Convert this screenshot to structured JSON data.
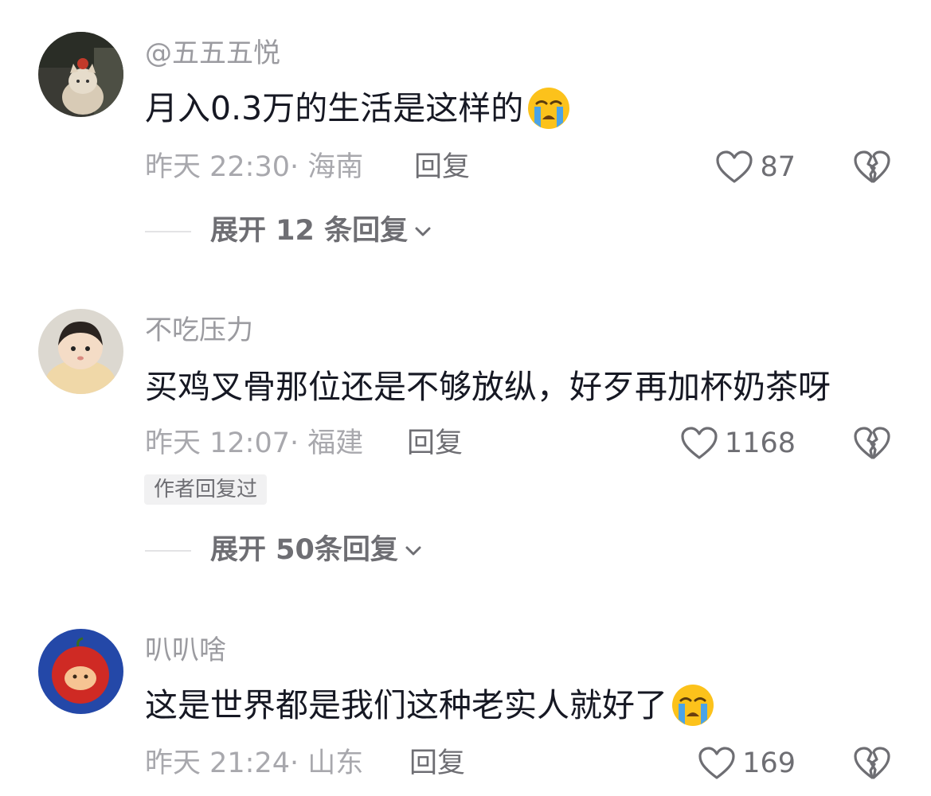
{
  "comments": [
    {
      "username": "@五五五悦",
      "text": "月入0.3万的生活是这样的",
      "emoji": "loudly-crying-face",
      "time_location": "昨天 22:30· 海南",
      "reply_label": "回复",
      "likes": "87",
      "expand_label": "展开 12 条回复"
    },
    {
      "username": "不吃压力",
      "text": "买鸡叉骨那位还是不够放纵，好歹再加杯奶茶呀",
      "time_location": "昨天 12:07· 福建",
      "reply_label": "回复",
      "likes": "1168",
      "author_badge": "作者回复过",
      "expand_label": "展开 50条回复"
    },
    {
      "username": "叭叭啥",
      "text": "这是世界都是我们这种老实人就好了",
      "emoji": "loudly-crying-face",
      "time_location": "昨天 21:24· 山东",
      "reply_label": "回复",
      "likes": "169"
    }
  ],
  "colors": {
    "username": "#9b9ba0",
    "text": "#161823",
    "meta": "#a8a8ad",
    "action": "#6e6e73"
  }
}
